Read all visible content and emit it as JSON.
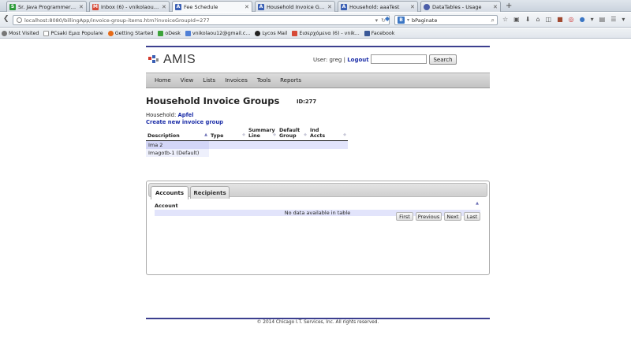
{
  "browser": {
    "tabs": [
      {
        "label": "Sr. Java Programmer - Web...",
        "icon": "green-s-icon",
        "color": "#2d9b3a"
      },
      {
        "label": "Inbox (6) - vnikolaou12@g...",
        "icon": "gmail-icon",
        "color": "#d64937"
      },
      {
        "label": "Fee Schedule",
        "icon": "amis-icon",
        "color": "#3a5fb4"
      },
      {
        "label": "Household Invoice Groups:...",
        "icon": "amis-icon",
        "color": "#3a5fb4"
      },
      {
        "label": "Household: aaaTest",
        "icon": "amis-icon",
        "color": "#3a5fb4"
      },
      {
        "label": "DataTables - Usage",
        "icon": "datatables-icon",
        "color": "#4a5da8"
      }
    ],
    "url": "localhost:8080/billingApp/invoice-group-items.htm?invoiceGroupId=277",
    "search_query": "bPaginate",
    "search_engine": "B",
    "bookmarks": [
      {
        "label": "Most Visited",
        "icon": "gear-icon",
        "color": "#777777"
      },
      {
        "label": "PCsaki Εμια Populare",
        "icon": "page-icon",
        "color": "#ffffff"
      },
      {
        "label": "Getting Started",
        "icon": "firefox-icon",
        "color": "#e66b18"
      },
      {
        "label": "oDesk",
        "icon": "odesk-icon",
        "color": "#3da33a"
      },
      {
        "label": "vnikolaou12@gmail.c...",
        "icon": "doc-icon",
        "color": "#4f7fd6"
      },
      {
        "label": "Lycos Mail",
        "icon": "lycos-icon",
        "color": "#222222"
      },
      {
        "label": "Εισερχόμενα (6) - vnik...",
        "icon": "gmail-icon",
        "color": "#d64937"
      },
      {
        "label": "Facebook",
        "icon": "facebook-icon",
        "color": "#3b5998"
      }
    ]
  },
  "app": {
    "logo_text": "AMIS",
    "user_prefix": "User:",
    "username": "greg",
    "logout_label": "Logout",
    "search_button": "Search",
    "search_value": "",
    "menu": [
      "Home",
      "View",
      "Lists",
      "Invoices",
      "Tools",
      "Reports"
    ]
  },
  "main": {
    "title": "Household Invoice Groups",
    "id_label": "ID:277",
    "household_prefix": "Household:",
    "household_name": "Apfel",
    "create_link": "Create new invoice group",
    "groups_table": {
      "columns": [
        "Description",
        "Type",
        "Summary Line",
        "Default Group",
        "Ind Accts"
      ],
      "rows": [
        [
          "Ima 2",
          "",
          "",
          "",
          ""
        ],
        [
          "Imagotb-1 (Default)",
          "",
          "",
          "",
          ""
        ]
      ]
    }
  },
  "panel": {
    "tabs": [
      "Accounts",
      "Recipients"
    ],
    "active_tab": "Accounts",
    "accounts_header": "Account",
    "empty_message": "No data available in table",
    "pager": [
      "First",
      "Previous",
      "Next",
      "Last"
    ]
  },
  "footer": {
    "text": "© 2014 Chicago I.T. Services, Inc. All rights reserved."
  },
  "colors": {
    "brand_line": "#3c3f8f",
    "link": "#1c2ea8",
    "row_highlight": "#e2e4fb"
  }
}
